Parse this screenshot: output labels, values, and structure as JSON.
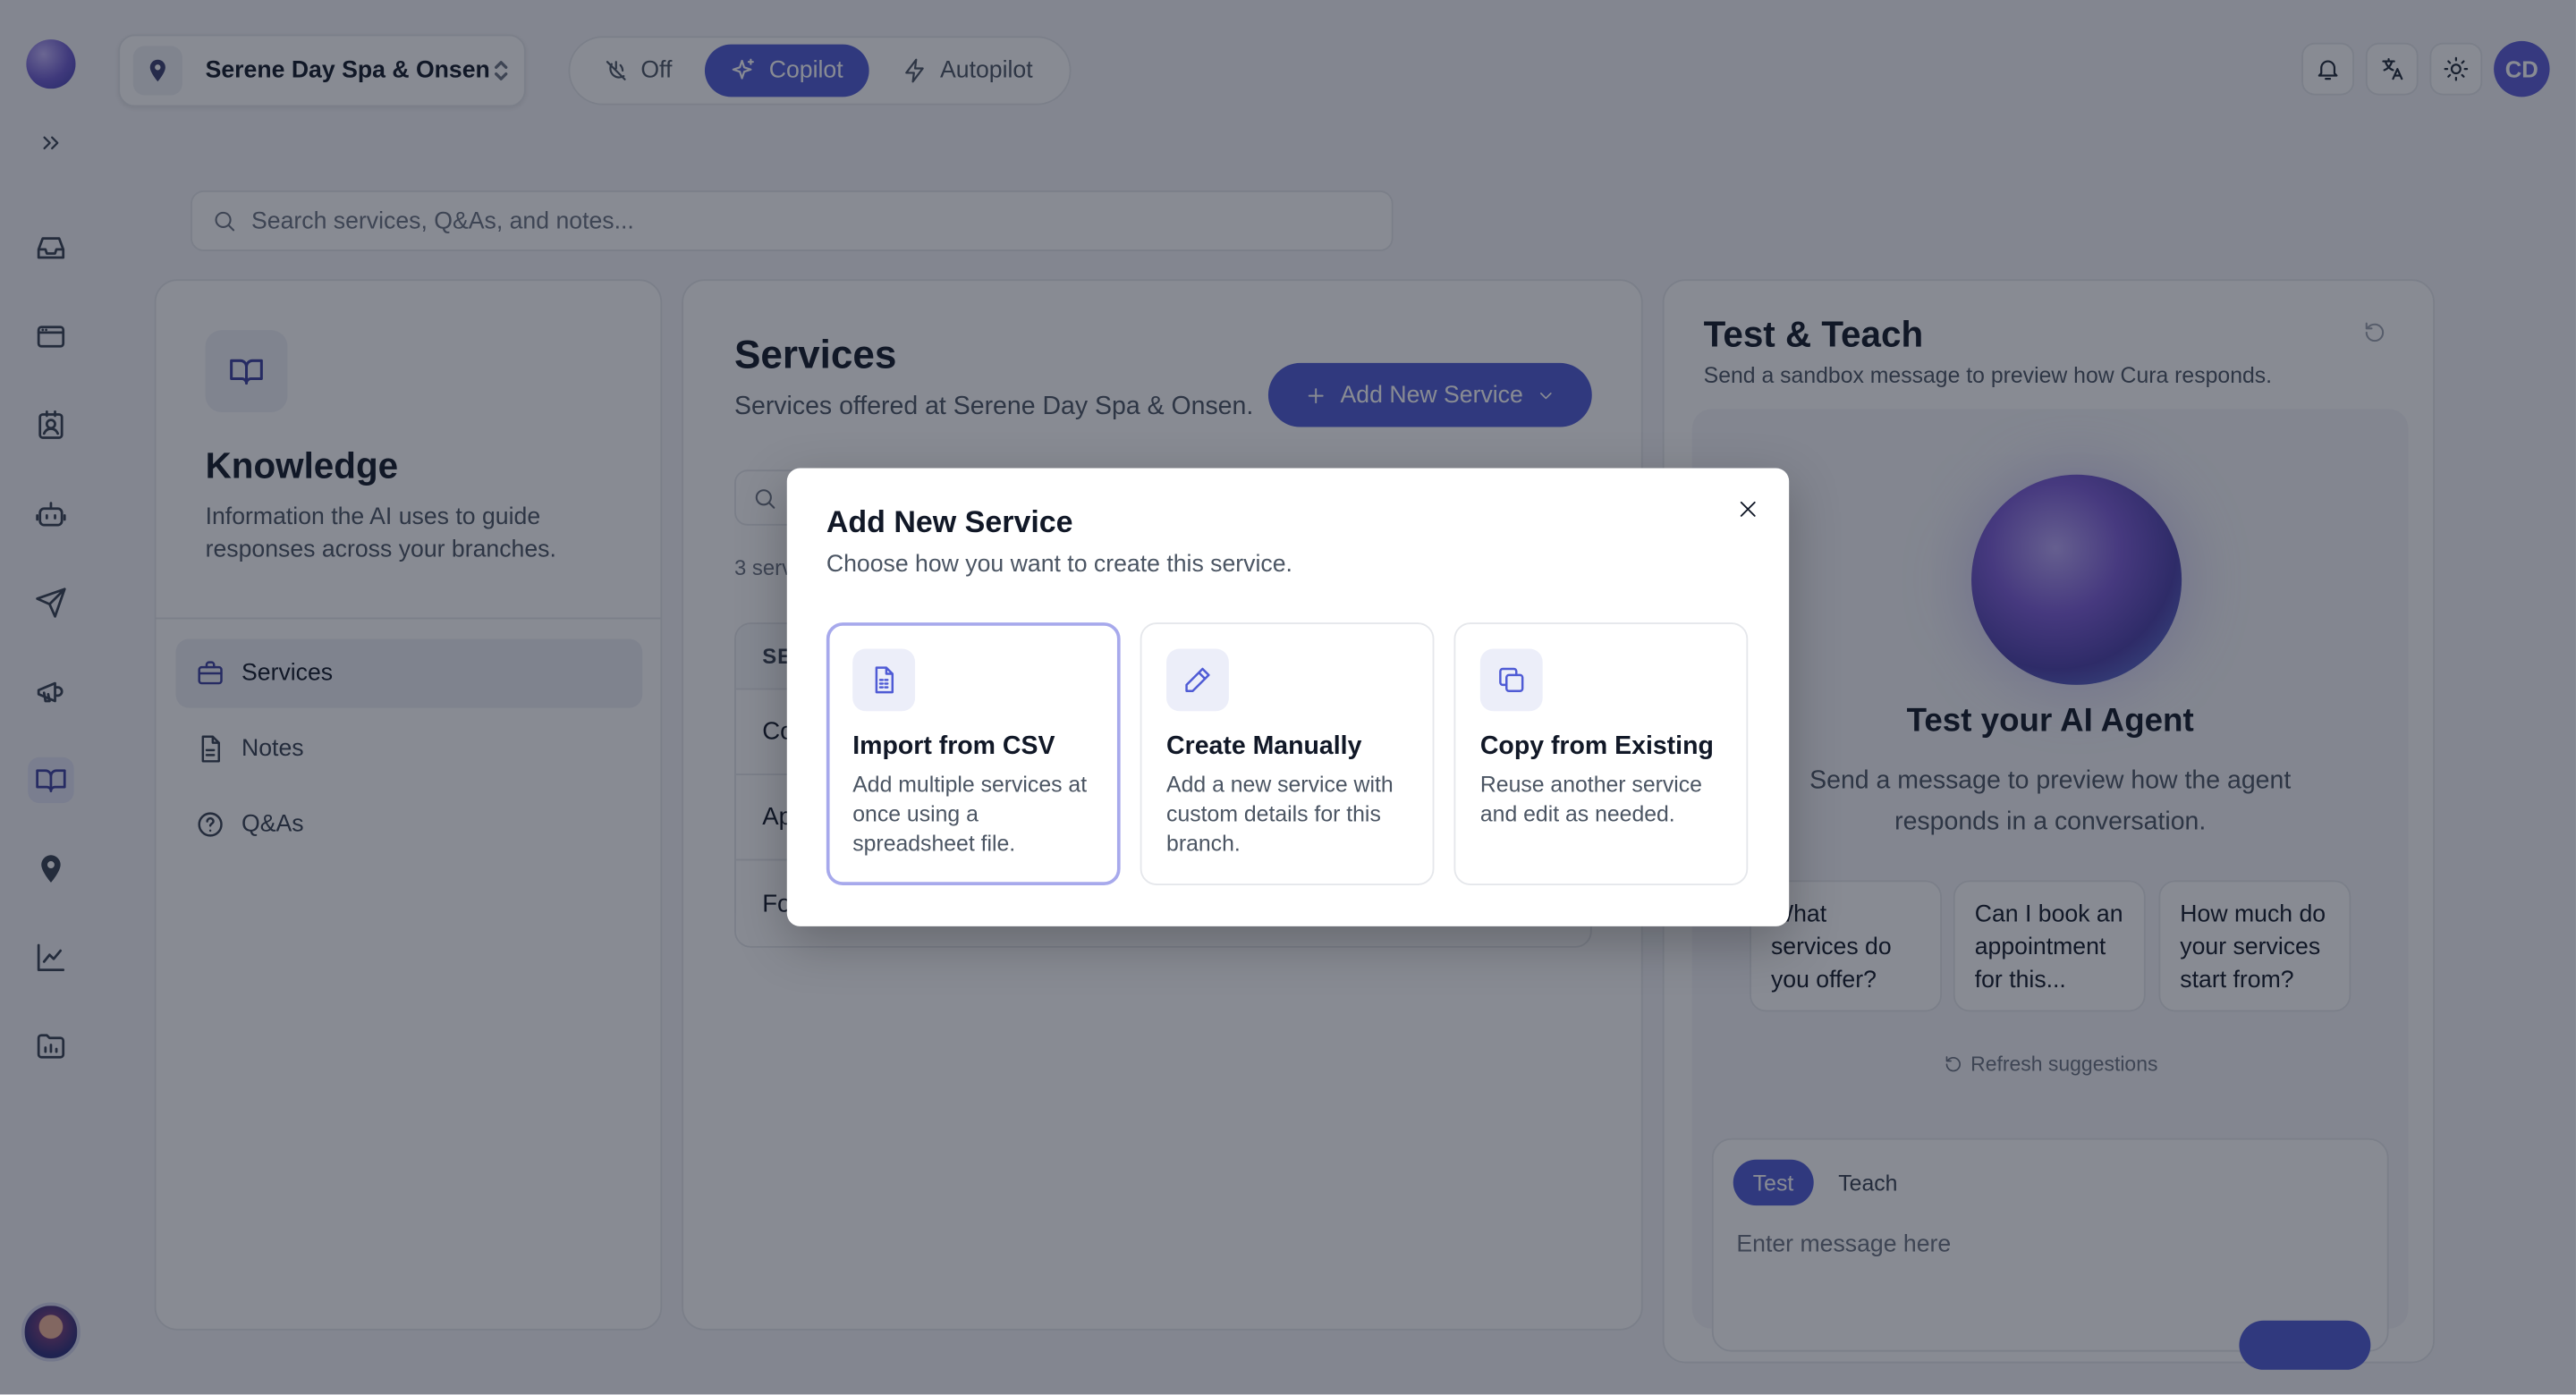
{
  "branch": {
    "name": "Serene Day Spa & Onsen"
  },
  "modes": {
    "off": "Off",
    "copilot": "Copilot",
    "autopilot": "Autopilot",
    "active": "Copilot"
  },
  "header": {
    "user_initials": "CD"
  },
  "search": {
    "placeholder": "Search services, Q&As, and notes..."
  },
  "knowledge": {
    "title": "Knowledge",
    "description": "Information the AI uses to guide responses across your branches.",
    "nav": [
      {
        "label": "Services",
        "icon": "briefcase-icon",
        "active": true
      },
      {
        "label": "Notes",
        "icon": "document-icon"
      },
      {
        "label": "Q&As",
        "icon": "question-circle-icon"
      }
    ]
  },
  "services": {
    "title": "Services",
    "description": "Services offered at Serene Day Spa & Onsen.",
    "add_button": "Add New Service",
    "count_text": "3 serv",
    "table_header": "SE",
    "rows": [
      "Co",
      "Ap",
      "Fo"
    ]
  },
  "test_teach": {
    "title": "Test & Teach",
    "description": "Send a sandbox message to preview how Cura responds.",
    "agent_title": "Test your AI Agent",
    "agent_description": "Send a message to preview how the agent responds in a conversation.",
    "suggestions": [
      "What services do you offer?",
      "Can I book an appointment for this...",
      "How much do your services start from?"
    ],
    "refresh_label": "Refresh suggestions",
    "tabs": {
      "test": "Test",
      "teach": "Teach"
    },
    "input_placeholder": "Enter message here"
  },
  "modal": {
    "title": "Add New Service",
    "description": "Choose how you want to create this service.",
    "options": [
      {
        "title": "Import from CSV",
        "description": "Add multiple services at once using a spreadsheet file.",
        "icon": "spreadsheet-file-icon",
        "selected": true
      },
      {
        "title": "Create Manually",
        "description": "Add a new service with custom details for this branch.",
        "icon": "pencil-icon"
      },
      {
        "title": "Copy from Existing",
        "description": "Reuse another service and edit as needed.",
        "icon": "copy-icon"
      }
    ]
  },
  "colors": {
    "accent": "#4f5bd5",
    "overlay": "#111827"
  }
}
